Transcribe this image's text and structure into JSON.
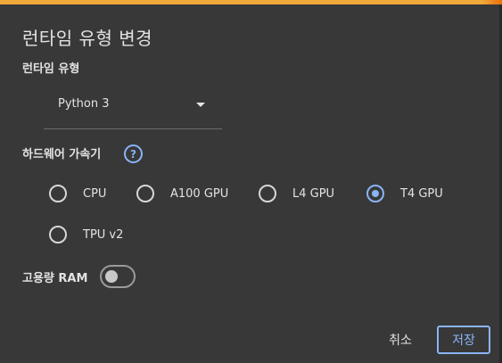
{
  "dialog": {
    "title": "런타임 유형 변경"
  },
  "runtime": {
    "label": "런타임 유형",
    "selected": "Python 3"
  },
  "accelerator": {
    "label": "하드웨어 가속기",
    "help_glyph": "?",
    "options": [
      {
        "label": "CPU",
        "checked": false
      },
      {
        "label": "A100 GPU",
        "checked": false
      },
      {
        "label": "L4 GPU",
        "checked": false
      },
      {
        "label": "T4 GPU",
        "checked": true
      },
      {
        "label": "TPU v2",
        "checked": false
      }
    ]
  },
  "high_ram": {
    "label": "고용량 RAM",
    "enabled": false
  },
  "buttons": {
    "cancel": "취소",
    "save": "저장"
  },
  "colors": {
    "accent": "#8ab4f8",
    "background": "#383838",
    "top_strip": "#f2a93b"
  }
}
